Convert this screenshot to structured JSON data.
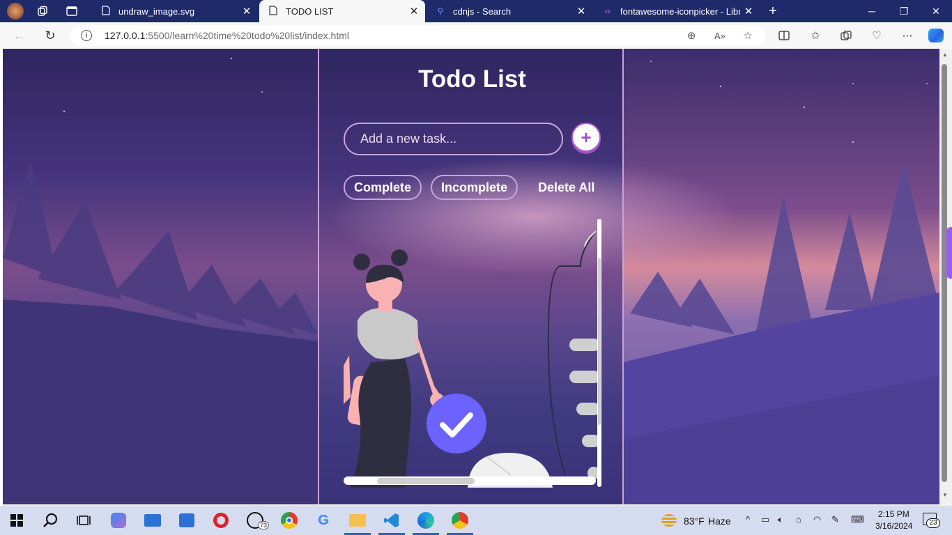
{
  "browser": {
    "tabs": [
      {
        "title": "undraw_image.svg",
        "icon": "file-icon",
        "active": false
      },
      {
        "title": "TODO LIST",
        "icon": "file-icon",
        "active": true
      },
      {
        "title": "cdnjs - Search",
        "icon": "search-icon",
        "active": false
      },
      {
        "title": "fontawesome-iconpicker - Librar",
        "icon": "code-icon",
        "active": false
      }
    ],
    "url_host": "127.0.0.1",
    "url_path": ":5500/learn%20time%20todo%20list/index.html"
  },
  "app": {
    "title": "Todo List",
    "input_placeholder": "Add a new task...",
    "add_label": "+",
    "filters": {
      "complete": "Complete",
      "incomplete": "Incomplete",
      "delete_all": "Delete All"
    }
  },
  "taskbar": {
    "whatsapp_badge": "73",
    "weather_temp": "83°F",
    "weather_desc": "Haze",
    "time": "2:15 PM",
    "date": "3/16/2024",
    "notification_count": "23"
  },
  "colors": {
    "accent": "#a64cc9",
    "check_circle": "#6c63ff",
    "tabbar": "#1f2a6b"
  }
}
